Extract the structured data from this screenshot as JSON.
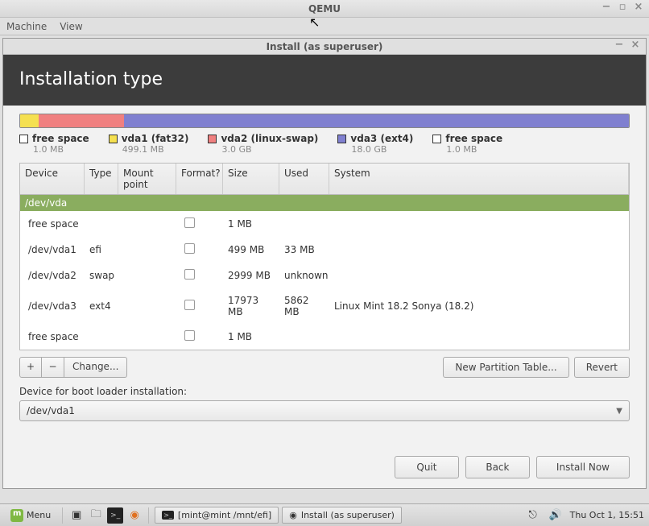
{
  "qemu": {
    "title": "QEMU",
    "menu": {
      "machine": "Machine",
      "view": "View"
    }
  },
  "install": {
    "title": "Install (as superuser)",
    "heading": "Installation type"
  },
  "bar_colors": {
    "free": "#cccccc",
    "fat32": "#f5e050",
    "swap": "#f08080",
    "ext4": "#8080d0"
  },
  "legend": [
    {
      "key": "free",
      "label": "free space",
      "sub": "1.0 MB",
      "color": "#ffffff"
    },
    {
      "key": "fat32",
      "label": "vda1 (fat32)",
      "sub": "499.1 MB",
      "color": "#f5e050"
    },
    {
      "key": "swap",
      "label": "vda2 (linux-swap)",
      "sub": "3.0 GB",
      "color": "#f08080"
    },
    {
      "key": "ext4",
      "label": "vda3 (ext4)",
      "sub": "18.0 GB",
      "color": "#8080d0"
    },
    {
      "key": "free2",
      "label": "free space",
      "sub": "1.0 MB",
      "color": "#ffffff"
    }
  ],
  "table": {
    "headers": {
      "device": "Device",
      "type": "Type",
      "mount": "Mount point",
      "format": "Format?",
      "size": "Size",
      "used": "Used",
      "system": "System"
    },
    "group_header": "/dev/vda",
    "rows": [
      {
        "device": "free space",
        "type": "",
        "mount": "",
        "size": "1 MB",
        "used": "",
        "system": ""
      },
      {
        "device": "/dev/vda1",
        "type": "efi",
        "mount": "",
        "size": "499 MB",
        "used": "33 MB",
        "system": ""
      },
      {
        "device": "/dev/vda2",
        "type": "swap",
        "mount": "",
        "size": "2999 MB",
        "used": "unknown",
        "system": ""
      },
      {
        "device": "/dev/vda3",
        "type": "ext4",
        "mount": "",
        "size": "17973 MB",
        "used": "5862 MB",
        "system": "Linux Mint 18.2 Sonya (18.2)"
      },
      {
        "device": "free space",
        "type": "",
        "mount": "",
        "size": "1 MB",
        "used": "",
        "system": ""
      }
    ],
    "toolbar": {
      "add": "+",
      "remove": "−",
      "change": "Change...",
      "new_table": "New Partition Table...",
      "revert": "Revert"
    }
  },
  "boot": {
    "label": "Device for boot loader installation:",
    "value": "/dev/vda1"
  },
  "nav": {
    "quit": "Quit",
    "back": "Back",
    "install": "Install Now"
  },
  "taskbar": {
    "menu": "Menu",
    "task1": "[mint@mint /mnt/efi]",
    "task2": "Install (as superuser)",
    "clock": "Thu Oct  1, 15:51"
  }
}
